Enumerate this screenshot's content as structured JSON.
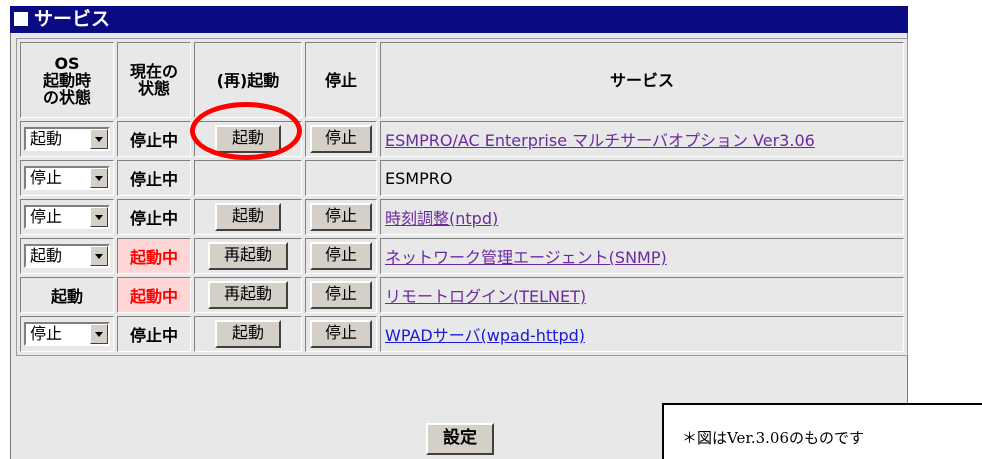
{
  "window": {
    "title": "サービス"
  },
  "headers": {
    "boot_state": "OS\n起動時\nの状態",
    "current_state": "現在の\n状態",
    "restart": "(再)起動",
    "stop": "停止",
    "service": "サービス"
  },
  "rows": [
    {
      "boot_select": "起動",
      "state": "停止中",
      "state_color": "#000000",
      "start_label": "起動",
      "stop_label": "停止",
      "service": "ESMPRO/AC Enterprise マルチサーバオプション Ver3.06",
      "service_link": true
    },
    {
      "boot_select": "停止",
      "state": "停止中",
      "state_color": "#000000",
      "start_label": "",
      "stop_label": "",
      "service": "ESMPRO",
      "service_link": false
    },
    {
      "boot_select": "停止",
      "state": "停止中",
      "state_color": "#000000",
      "start_label": "起動",
      "stop_label": "停止",
      "service": "時刻調整(ntpd)",
      "service_link": true
    },
    {
      "boot_select": "起動",
      "state": "起動中",
      "state_color": "#ff0000",
      "start_label": "再起動",
      "stop_label": "停止",
      "service": "ネットワーク管理エージェント(SNMP)",
      "service_link": true
    },
    {
      "boot_fixed": "起動",
      "state": "起動中",
      "state_color": "#ff0000",
      "start_label": "再起動",
      "stop_label": "停止",
      "service": "リモートログイン(TELNET)",
      "service_link": true
    },
    {
      "boot_select": "停止",
      "state": "停止中",
      "state_color": "#000000",
      "start_label": "起動",
      "stop_label": "停止",
      "service": "WPADサーバ(wpad-httpd)",
      "service_link": true
    }
  ],
  "footer": {
    "apply_label": "設定"
  },
  "note": "＊図はVer.3.06のものです",
  "colors": {
    "titlebar": "#0a0a82",
    "running": "#ff0000",
    "link_visited": "#6b2aa0",
    "link": "#1a1ad6",
    "highlight_circle": "#ff0000"
  }
}
